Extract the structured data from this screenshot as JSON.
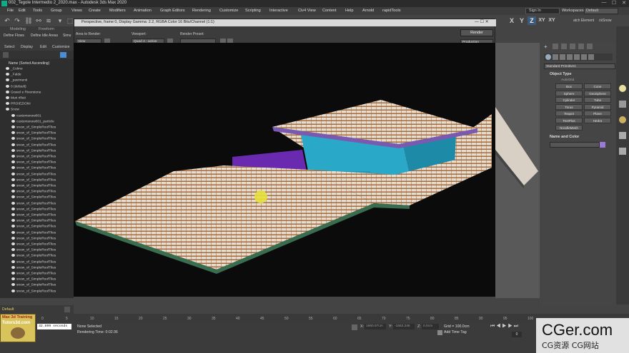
{
  "titlebar": {
    "title": "002_Tegole Intermedio 2_2020.max - Autodesk 3ds Max 2020",
    "minimize": "—",
    "maximize": "☐",
    "close": "✕"
  },
  "menubar": {
    "items": [
      "File",
      "Edit",
      "Tools",
      "Group",
      "Views",
      "Create",
      "Modifiers",
      "Animation",
      "Graph Editors",
      "Rendering",
      "Customize",
      "Scripting",
      "Interactive",
      "Civ4 View",
      "Content",
      "Help",
      "Arnold",
      "rapidTools"
    ],
    "signin": "Sign In",
    "workspaces_label": "Workspaces:",
    "workspace_value": "Default"
  },
  "toolbar": {
    "axis_labels": [
      "X",
      "Y",
      "Z",
      "XY",
      "XY"
    ],
    "right_labels": [
      "atch Element",
      "ckSnow"
    ]
  },
  "ribbon": {
    "tabs": [
      "Modeling",
      "Freeform"
    ],
    "items": [
      "Define Flows",
      "Define Idle Areas",
      "Simu"
    ]
  },
  "scene_explorer": {
    "menu": [
      "Select",
      "Display",
      "Edit",
      "Customize"
    ],
    "header": "Name (Sorted Ascending)",
    "rows": [
      "_Colmo",
      "_Falde",
      "_pavimenti",
      "0 (default)",
      "Gravel e Riverstone",
      "Muri rifiuti",
      "PROIEZIONI",
      "Snow",
      "customsnow001",
      "customsnow001_particle",
      "snow_of_SimpleRoofTiles",
      "snow_of_SimpleRoofTiles",
      "snow_of_SimpleRoofTiles",
      "snow_of_SimpleRoofTiles",
      "snow_of_SimpleRoofTiles",
      "snow_of_SimpleRoofTiles",
      "snow_of_SimpleRoofTiles",
      "snow_of_SimpleRoofTiles",
      "snow_of_SimpleRoofTiles",
      "snow_of_SimpleRoofTiles",
      "snow_of_SimpleRoofTiles",
      "snow_of_SimpleRoofTiles",
      "snow_of_SimpleRoofTiles",
      "snow_of_SimpleRoofTiles",
      "snow_of_SimpleRoofTiles",
      "snow_of_SimpleRoofTiles",
      "snow_of_SimpleRoofTiles",
      "snow_of_SimpleRoofTiles",
      "snow_of_SimpleRoofTiles",
      "snow_of_SimpleRoofTiles",
      "snow_of_SimpleRoofTiles",
      "snow_of_SimpleRoofTiles",
      "snow_of_SimpleRoofTiles",
      "snow_of_SimpleRoofTiles",
      "snow_of_SimpleRoofTiles",
      "snow_of_SimpleRoofTiles",
      "snow_of_SimpleRoofTiles",
      "snow_of_SimpleRoofTiles",
      "snow_of_SimpleRoofTiles",
      "snow_of_SimpleRoofTiles",
      "snow_of_SimpleRoofTiles",
      "snow_of_SimpleRoofTiles",
      "snow_of_SimpleRoofTiles"
    ],
    "layer": "Default"
  },
  "render_dialog": {
    "title": "Perspective, frame 0, Display Gamma: 2.2, RGBA Color 16 Bits/Channel (1:1)",
    "area_label": "Area to Render:",
    "area_value": "View",
    "viewport_label": "Viewport:",
    "viewport_value": "Quad 4 - active",
    "preset_label": "Render Preset:",
    "preset_value": "",
    "channel_value": "RGB Alpha",
    "render_button": "Render",
    "production_value": "Production"
  },
  "command_panel": {
    "dropdown": "Standard Primitives",
    "object_type_header": "Object Type",
    "autogrid": "AutoGrid",
    "buttons": [
      "Box",
      "Cone",
      "Sphere",
      "GeoSphere",
      "Cylinder",
      "Tube",
      "Torus",
      "Pyramid",
      "Teapot",
      "Plane",
      "TextPlus",
      "Hedra",
      "NoodleMesh"
    ],
    "name_color_header": "Name and Color"
  },
  "timeline": {
    "ticks": [
      "0",
      "5",
      "10",
      "15",
      "20",
      "25",
      "30",
      "35",
      "40",
      "45",
      "50",
      "55",
      "60",
      "65",
      "70",
      "75",
      "80",
      "85",
      "90",
      "95",
      "100"
    ]
  },
  "status": {
    "logo_line1": "Max 3d Training",
    "logo_line2": "Tutors3d.com",
    "script_value": "32.899 seconds",
    "selection": "None Selected",
    "render_time": "Rendering Time: 0:02:36",
    "x_label": "X:",
    "x_value": "1960.97cm",
    "y_label": "Y:",
    "y_value": "-1552.246",
    "z_label": "Z:",
    "z_value": "0.0cm",
    "grid": "Grid = 100.0cm",
    "add_time_tag": "Add Time Tag",
    "frame": "0"
  },
  "watermark": {
    "brand": "CGer.com",
    "sub": "CG资源 CG网站"
  },
  "colors": {
    "roof_snow": "#e8e2d8",
    "tile_brown": "#a66a3c",
    "wall_cyan": "#2aa8c8",
    "wall_purple": "#6a2ab0",
    "cursor_yellow": "#e6e13a"
  }
}
